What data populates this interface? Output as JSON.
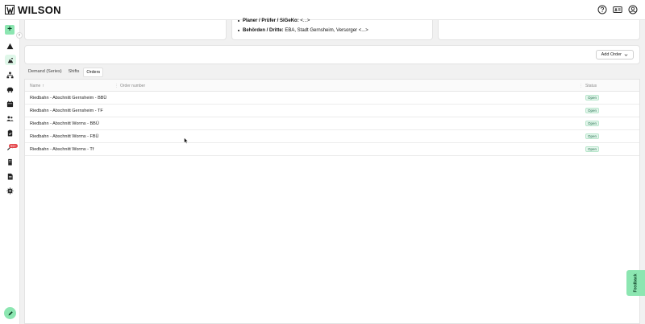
{
  "app": {
    "brand": "WILSON"
  },
  "header": {
    "icons": [
      "help-icon",
      "id-card-icon",
      "user-account-icon"
    ]
  },
  "sidebar": {
    "add_label": "+",
    "notification_badge": "99+",
    "items": [
      {
        "icon": "warning-icon"
      },
      {
        "icon": "construction-icon",
        "active": true
      },
      {
        "icon": "hierarchy-icon"
      },
      {
        "icon": "vehicle-icon"
      },
      {
        "icon": "calendar-icon"
      },
      {
        "icon": "people-icon"
      },
      {
        "icon": "clipboard-icon"
      },
      {
        "icon": "tools-icon"
      },
      {
        "icon": "building-icon"
      },
      {
        "icon": "document-icon"
      },
      {
        "icon": "gear-icon"
      }
    ]
  },
  "info_card": {
    "line1_label": "Planer / Prüfer / SiGeKo:",
    "line1_value": " <...>",
    "line2_label": "Behörden / Dritte:",
    "line2_value": " EBA, Stadt Gernsheim, Versorger <...>"
  },
  "actions": {
    "add_order_label": "Add Order"
  },
  "tabs": [
    {
      "label": "Demand (Series)",
      "active": false
    },
    {
      "label": "Shifts",
      "active": false
    },
    {
      "label": "Orders",
      "active": true
    }
  ],
  "table": {
    "columns": {
      "name": "Name",
      "order_number": "Order number",
      "status": "Status"
    },
    "rows": [
      {
        "name": "Riedbahn - Abschnitt Gernsheim - BBÜ",
        "order_number": "",
        "status": "Open"
      },
      {
        "name": "Riedbahn - Abschnitt Gernsheim - TF",
        "order_number": "",
        "status": "Open"
      },
      {
        "name": "Riedbahn - Abschnitt Worms - BBÜ",
        "order_number": "",
        "status": "Open"
      },
      {
        "name": "Riedbahn - Abschnitt Worms - FBÜ",
        "order_number": "",
        "status": "Open"
      },
      {
        "name": "Riedbahn - Abschnitt Worms - Tf",
        "order_number": "",
        "status": "Open"
      }
    ]
  },
  "feedback": {
    "label": "Feedback"
  },
  "colors": {
    "accent": "#8ce6b1",
    "status_open_bg": "#e3f6ec",
    "status_open_text": "#1f6f4a"
  }
}
